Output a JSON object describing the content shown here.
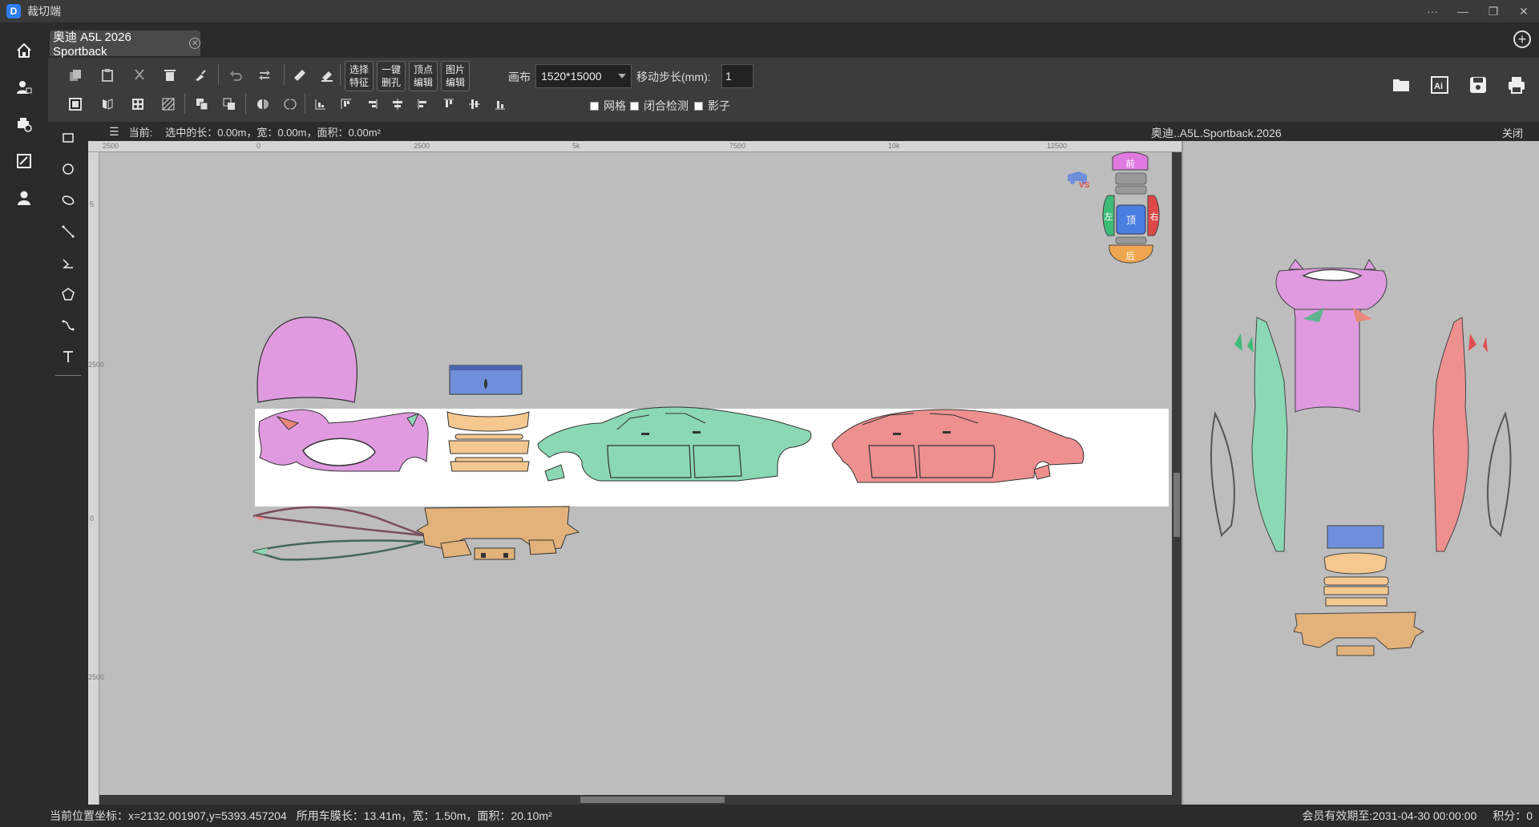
{
  "app": {
    "title": "裁切端"
  },
  "tab": {
    "label": "奥迪 A5L 2026 Sportback"
  },
  "toolbar": {
    "btn_select_feature": "选择\n特征",
    "btn_one_click_hole": "一键\n删孔",
    "btn_vertex_edit": "顶点\n编辑",
    "btn_image_edit": "图片\n编辑",
    "canvas_label": "画布",
    "canvas_value": "1520*15000",
    "step_label": "移动步长(mm):",
    "step_value": "1",
    "grid_label": "网格",
    "closed_check_label": "闭合检测",
    "shadow_label": "影子"
  },
  "infobar": {
    "current_label": "当前:",
    "selection_text": "选中的长：0.00m，宽：0.00m，面积：0.00m²"
  },
  "preview": {
    "title": "奥迪..A5L.Sportback.2026",
    "close_label": "关闭"
  },
  "ruler": {
    "top_labels": [
      "2500",
      "0",
      "2500",
      "5k",
      "7500",
      "10k",
      "12500"
    ],
    "left_labels": [
      "5",
      "2500",
      "0",
      "2500"
    ]
  },
  "view_cube": {
    "front": "前",
    "left": "左",
    "top": "顶",
    "right": "右",
    "back": "后",
    "vs_label": "VS"
  },
  "status": {
    "position": "当前位置坐标：x=2132.001907,y=5393.457204",
    "film_usage": "所用车膜长：13.41m，宽：1.50m，面积：20.10m²",
    "membership": "会员有效期至:2031-04-30 00:00:00",
    "points": "积分：0"
  },
  "colors": {
    "hood": "#e09ae0",
    "roof": "#6f8fdb",
    "left_side": "#8bd8b4",
    "right_side": "#ee9090",
    "bumper": "#f5c890",
    "bumper_dark": "#e2b27a",
    "selected_strip": "#ffffff",
    "canvas_bg": "#bdbdbd"
  }
}
